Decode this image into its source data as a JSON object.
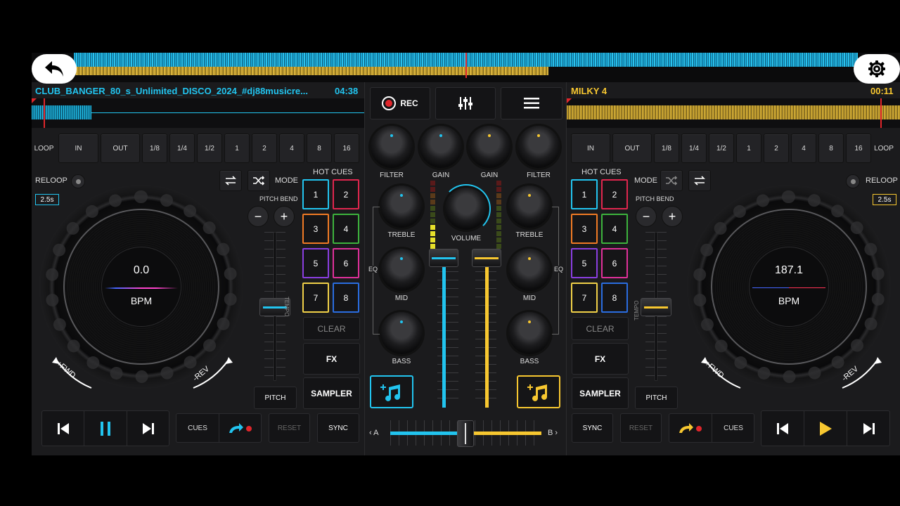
{
  "colors": {
    "deck_a": "#22c4ef",
    "deck_b": "#f7c730",
    "record": "#e0262b",
    "bg": "#1b1b1d"
  },
  "top_bar": {
    "back_icon": "back-arrow-icon",
    "settings_icon": "gear-icon"
  },
  "deck_a": {
    "title": "CLUB_BANGER_80_s_Unlimited_DISCO_2024_#dj88musicre...",
    "time": "04:38",
    "loop_buttons": [
      "LOOP",
      "IN",
      "OUT",
      "1/8",
      "1/4",
      "1/2",
      "1",
      "2",
      "4",
      "8",
      "16"
    ],
    "reloop": "RELOOP",
    "loop_length": "2.5s",
    "mode": "MODE",
    "hot_cues": "HOT CUES",
    "pitch_bend": "PITCH BEND",
    "bpm_value": "0.0",
    "bpm_label": "BPM",
    "fwd": "+FWD",
    "rev": "-REV",
    "pads": [
      "1",
      "2",
      "3",
      "4",
      "5",
      "6",
      "7",
      "8"
    ],
    "tempo": "TEMPO",
    "clear": "CLEAR",
    "fx": "FX",
    "sampler": "SAMPLER",
    "pitch": "PITCH",
    "cues": "CUES",
    "reset": "RESET",
    "sync": "SYNC",
    "minus": "−",
    "plus": "+"
  },
  "deck_b": {
    "title": "MILKY 4",
    "time": "00:11",
    "loop_buttons": [
      "IN",
      "OUT",
      "1/8",
      "1/4",
      "1/2",
      "1",
      "2",
      "4",
      "8",
      "16",
      "LOOP"
    ],
    "reloop": "RELOOP",
    "loop_length": "2.5s",
    "mode": "MODE",
    "hot_cues": "HOT CUES",
    "pitch_bend": "PITCH BEND",
    "bpm_value": "187.1",
    "bpm_label": "BPM",
    "fwd": "+FWD",
    "rev": "-REV",
    "pads": [
      "1",
      "2",
      "3",
      "4",
      "5",
      "6",
      "7",
      "8"
    ],
    "tempo": "TEMPO",
    "clear": "CLEAR",
    "fx": "FX",
    "sampler": "SAMPLER",
    "pitch": "PITCH",
    "cues": "CUES",
    "reset": "RESET",
    "sync": "SYNC",
    "minus": "−",
    "plus": "+"
  },
  "mixer": {
    "rec": "REC",
    "filter": "FILTER",
    "gain": "GAIN",
    "treble": "TREBLE",
    "mid": "MID",
    "bass": "BASS",
    "volume": "VOLUME",
    "eq": "EQ",
    "crossfader_a": "A",
    "crossfader_b": "B",
    "crossfader_position": 0.5
  }
}
